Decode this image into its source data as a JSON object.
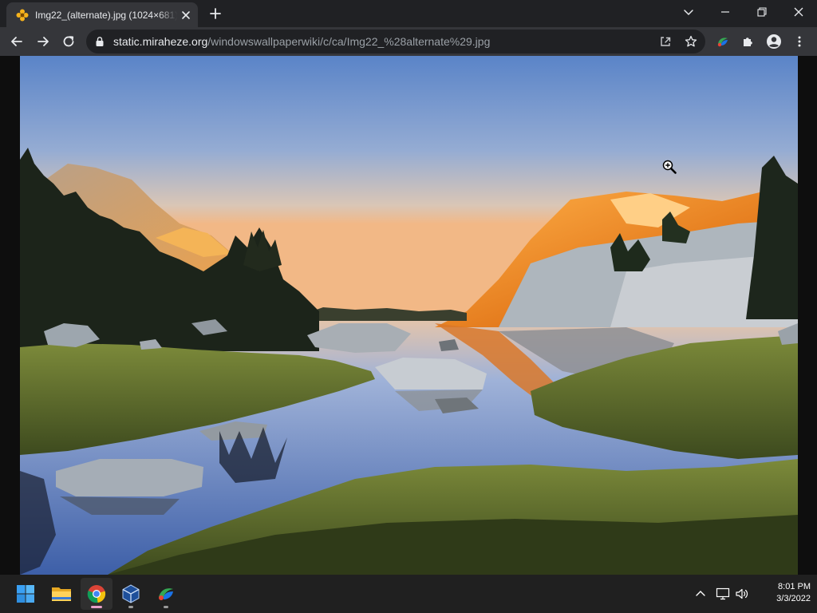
{
  "browser": {
    "tab": {
      "title": "Img22_(alternate).jpg (1024×681)",
      "favicon": "flower-favicon-icon"
    },
    "new_tab_icon": "plus-icon",
    "window_controls": [
      "chevron-down-icon",
      "minimize-icon",
      "restore-icon",
      "close-icon"
    ],
    "toolbar": {
      "back_icon": "arrow-left-icon",
      "forward_icon": "arrow-right-icon",
      "reload_icon": "reload-icon",
      "url_host": "static.miraheze.org",
      "url_path": "/windowswallpaperwiki/c/ca/Img22_%28alternate%29.jpg",
      "share_icon": "share-icon",
      "bookmark_icon": "star-icon",
      "extensions": [
        "colorful-extension-icon",
        "puzzle-icon"
      ],
      "profile_icon": "profile-icon",
      "menu_icon": "kebab-menu-icon"
    }
  },
  "content": {
    "image_subject": "mountain-lake-sunset-photo",
    "cursor": "zoom-in-cursor-icon"
  },
  "taskbar": {
    "apps": [
      {
        "name": "start",
        "icon": "windows-logo-icon"
      },
      {
        "name": "file-explorer",
        "icon": "folder-icon"
      },
      {
        "name": "chrome",
        "icon": "chrome-icon",
        "active": true
      },
      {
        "name": "virtualbox",
        "icon": "virtualbox-icon"
      },
      {
        "name": "extension-app",
        "icon": "colorful-app-icon"
      }
    ],
    "tray": [
      "chevron-up-icon",
      "network-icon",
      "volume-icon"
    ],
    "time": "8:01 PM",
    "date": "3/3/2022"
  },
  "colors": {
    "tabstrip": "#202124",
    "toolbar": "#35363a",
    "omnibox": "#202124",
    "taskbar": "#202020",
    "accent_blue": "#60cdff"
  }
}
